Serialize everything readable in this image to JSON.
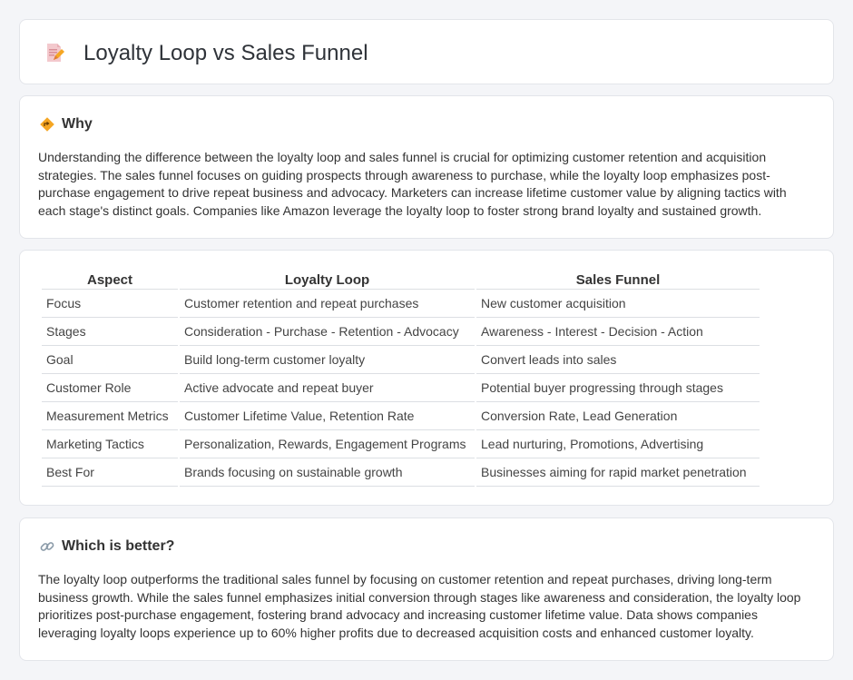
{
  "header": {
    "title": "Loyalty Loop vs Sales Funnel"
  },
  "why": {
    "heading": "Why",
    "text": "Understanding the difference between the loyalty loop and sales funnel is crucial for optimizing customer retention and acquisition strategies. The sales funnel focuses on guiding prospects through awareness to purchase, while the loyalty loop emphasizes post-purchase engagement to drive repeat business and advocacy. Marketers can increase lifetime customer value by aligning tactics with each stage's distinct goals. Companies like Amazon leverage the loyalty loop to foster strong brand loyalty and sustained growth."
  },
  "table": {
    "headers": [
      "Aspect",
      "Loyalty Loop",
      "Sales Funnel"
    ],
    "rows": [
      [
        "Focus",
        "Customer retention and repeat purchases",
        "New customer acquisition"
      ],
      [
        "Stages",
        "Consideration - Purchase - Retention - Advocacy",
        "Awareness - Interest - Decision - Action"
      ],
      [
        "Goal",
        "Build long-term customer loyalty",
        "Convert leads into sales"
      ],
      [
        "Customer Role",
        "Active advocate and repeat buyer",
        "Potential buyer progressing through stages"
      ],
      [
        "Measurement Metrics",
        "Customer Lifetime Value, Retention Rate",
        "Conversion Rate, Lead Generation"
      ],
      [
        "Marketing Tactics",
        "Personalization, Rewards, Engagement Programs",
        "Lead nurturing, Promotions, Advertising"
      ],
      [
        "Best For",
        "Brands focusing on sustainable growth",
        "Businesses aiming for rapid market penetration"
      ]
    ]
  },
  "better": {
    "heading": "Which is better?",
    "text": "The loyalty loop outperforms the traditional sales funnel by focusing on customer retention and repeat purchases, driving long-term business growth. While the sales funnel emphasizes initial conversion through stages like awareness and consideration, the loyalty loop prioritizes post-purchase engagement, fostering brand advocacy and increasing customer lifetime value. Data shows companies leveraging loyalty loops experience up to 60% higher profits due to decreased acquisition costs and enhanced customer loyalty."
  },
  "icons": {
    "header": "document-pencil-icon",
    "why": "diamond-sign-icon",
    "better": "link-icon"
  },
  "colors": {
    "background": "#f4f5f8",
    "card": "#ffffff",
    "accent_orange": "#f5a623",
    "icon_pink": "#e8a0a6"
  }
}
